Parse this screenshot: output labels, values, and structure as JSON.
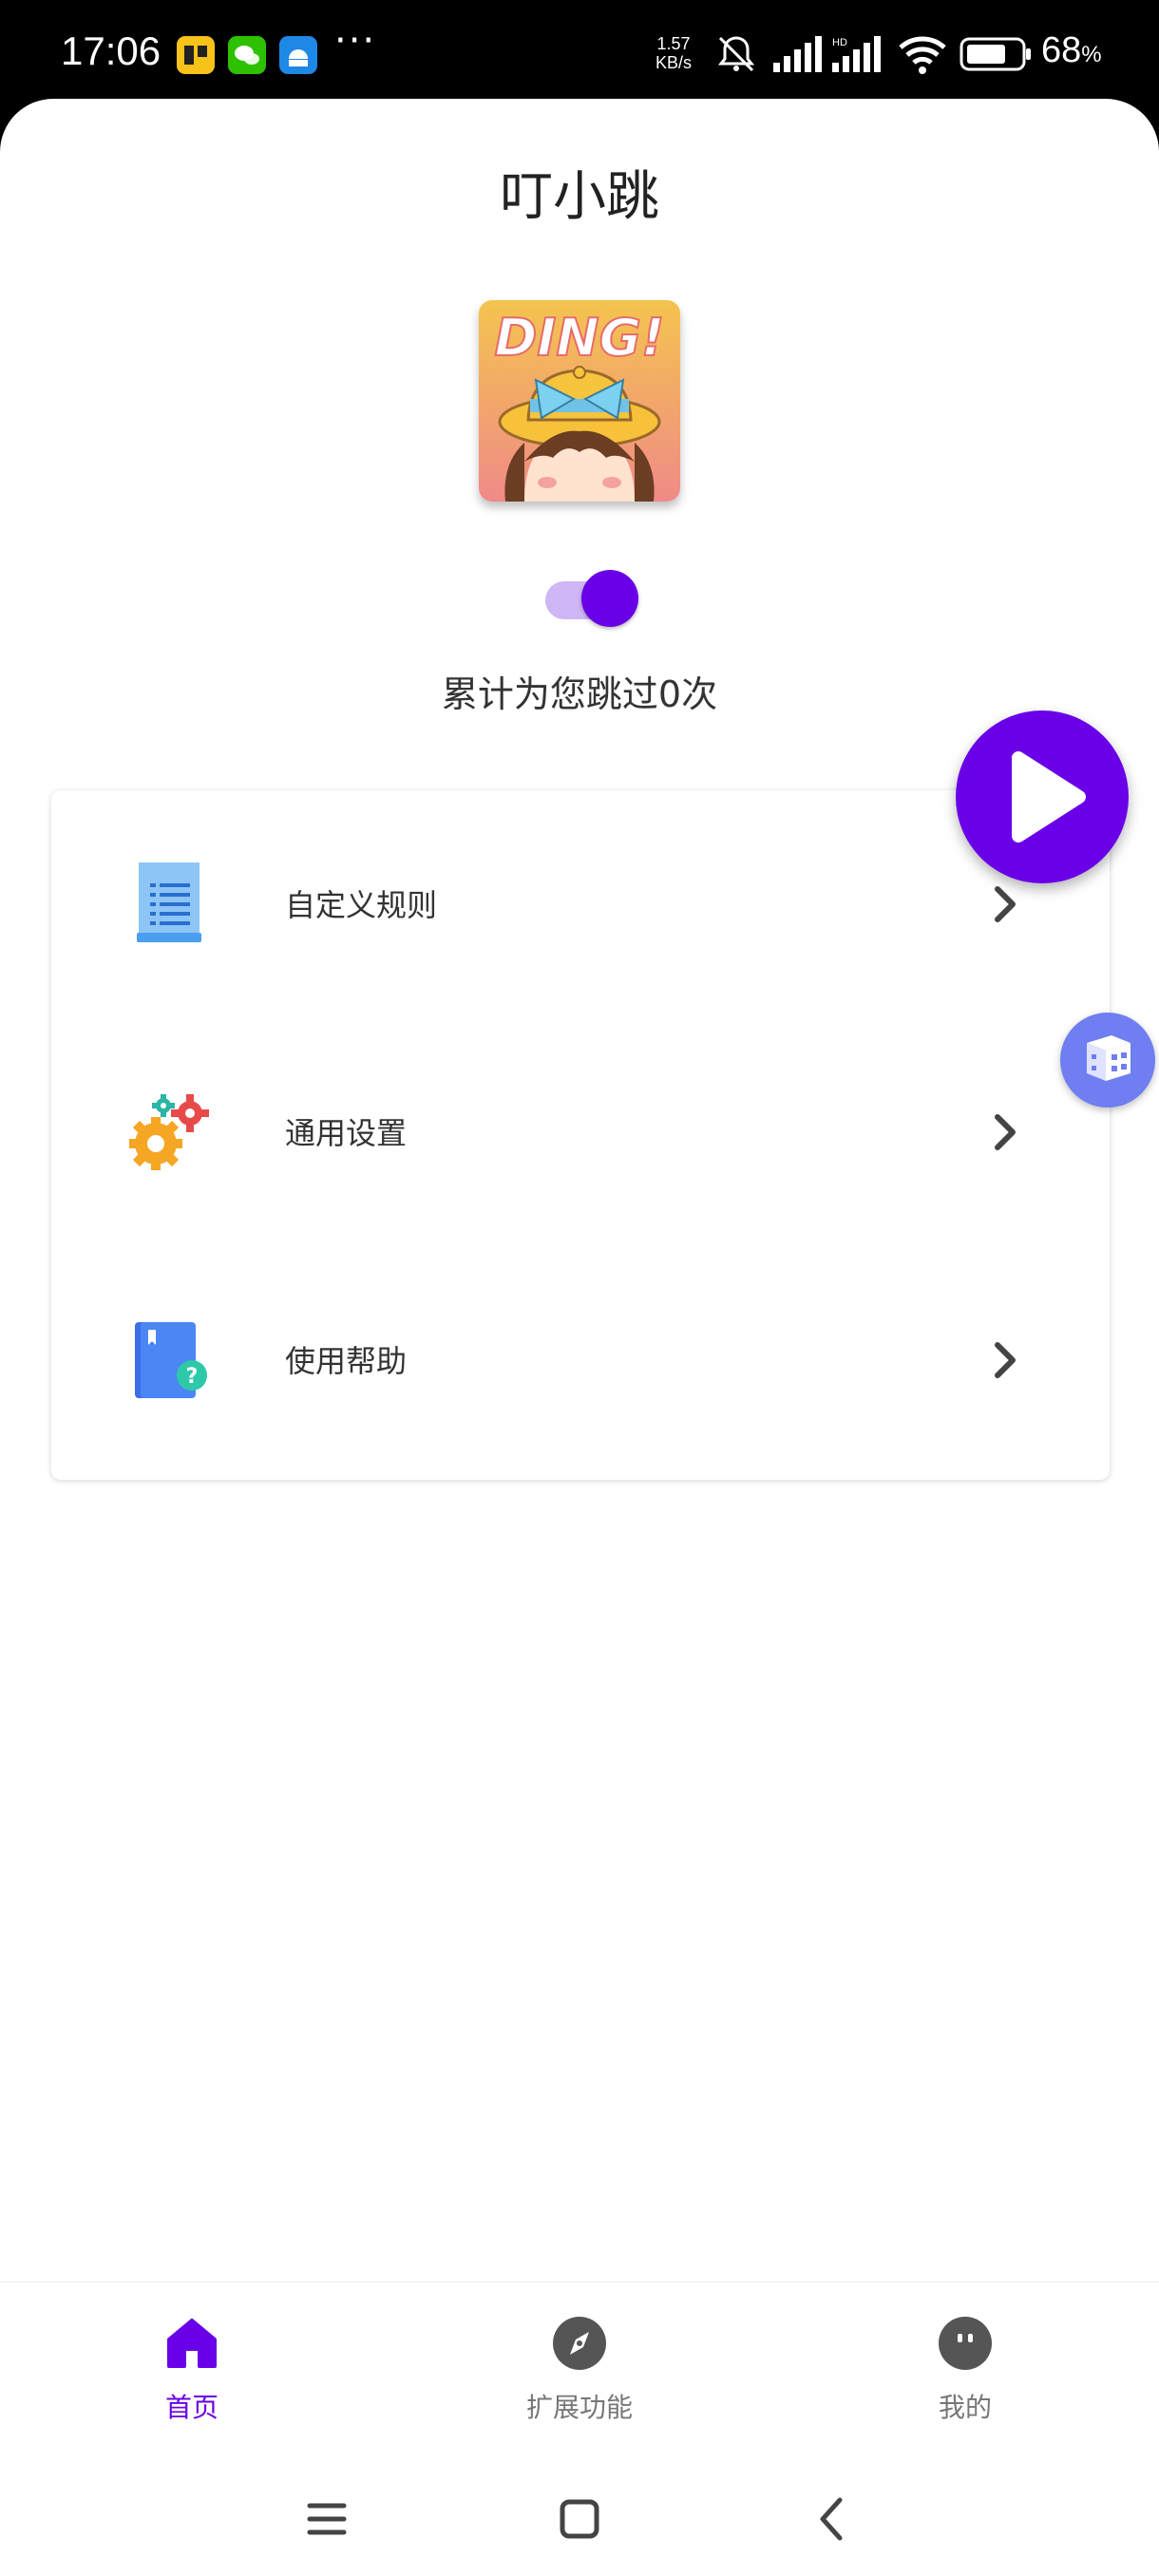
{
  "status_bar": {
    "time": "17:06",
    "net_speed_value": "1.57",
    "net_speed_unit": "KB/s",
    "battery_percent": "68",
    "battery_unit": "%",
    "more": "···",
    "icons": [
      "notification-app-icon",
      "wechat-icon",
      "android-icon",
      "mute-icon",
      "signal-icon",
      "signal-hd-icon",
      "wifi-icon",
      "battery-icon"
    ]
  },
  "header": {
    "title": "叮小跳"
  },
  "profile": {
    "avatar_text": "DING!",
    "switch_on": true
  },
  "stats": {
    "skip_count_text": "累计为您跳过0次"
  },
  "menu": {
    "items": [
      {
        "label": "自定义规则",
        "icon": "document-list-icon"
      },
      {
        "label": "通用设置",
        "icon": "gears-icon"
      },
      {
        "label": "使用帮助",
        "icon": "help-book-icon"
      }
    ]
  },
  "fab": {
    "icon": "play-icon"
  },
  "floating": {
    "icon": "cube-icon"
  },
  "bottom_nav": {
    "items": [
      {
        "label": "首页",
        "icon": "home-icon",
        "active": true
      },
      {
        "label": "扩展功能",
        "icon": "compass-icon",
        "active": false
      },
      {
        "label": "我的",
        "icon": "profile-face-icon",
        "active": false
      }
    ]
  },
  "colors": {
    "accent": "#6A00E8",
    "switch_track": "#CFB6F5",
    "cube": "#6F7EF0"
  }
}
